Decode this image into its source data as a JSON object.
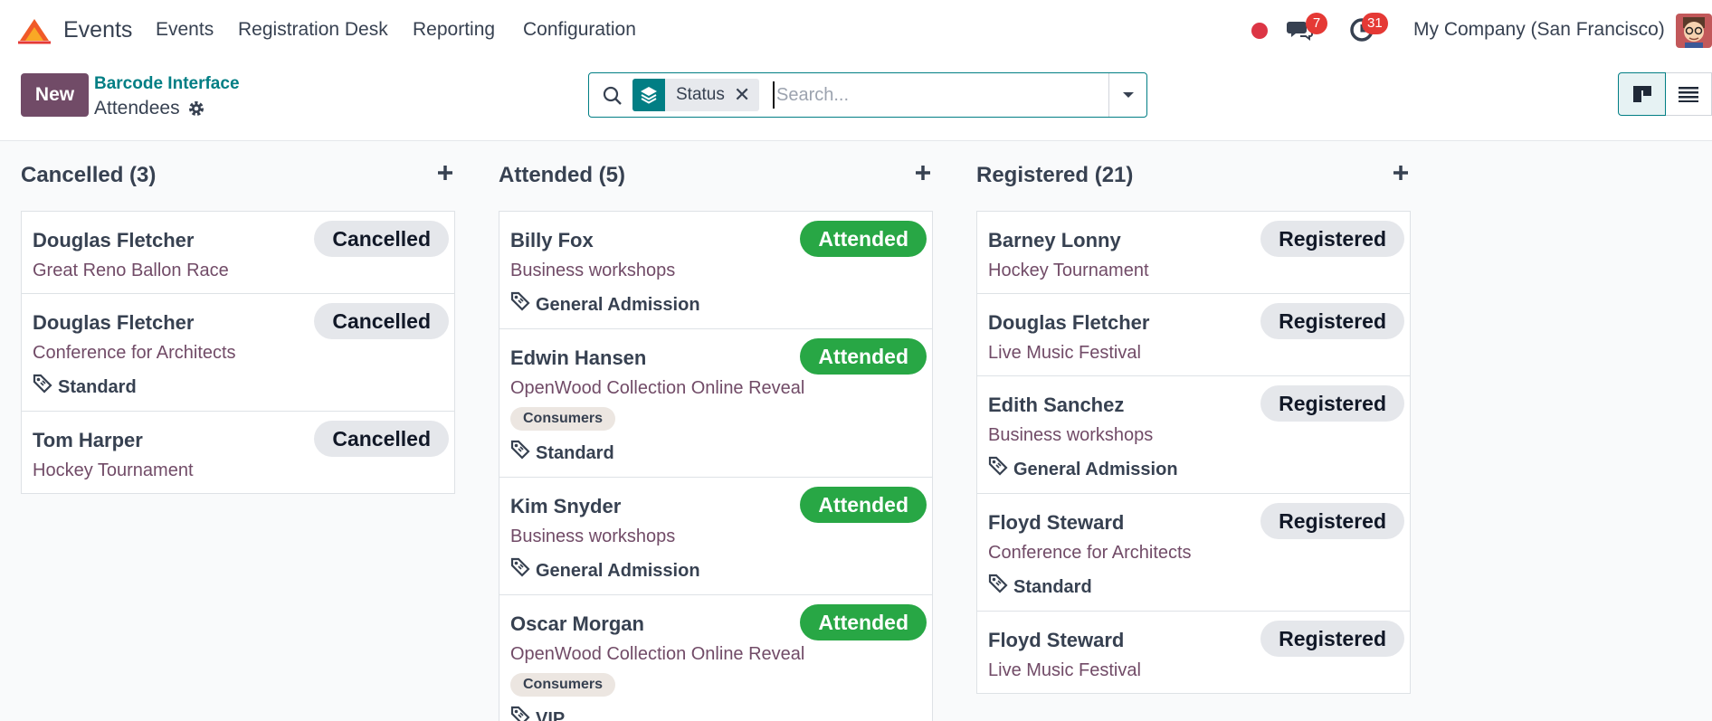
{
  "navbar": {
    "app_name": "Events",
    "menu": [
      "Events",
      "Registration Desk",
      "Reporting",
      "Configuration"
    ],
    "messages_count": "7",
    "activities_count": "31",
    "company": "My Company (San Francisco)",
    "icons": [
      "odoo-logo-icon",
      "recording-dot-icon",
      "chat-icon",
      "clock-icon",
      "user-avatar"
    ]
  },
  "control": {
    "new_label": "New",
    "breadcrumb_link": "Barcode Interface",
    "breadcrumb_current": "Attendees",
    "search": {
      "facet_label": "Status",
      "placeholder": "Search..."
    },
    "views": [
      "kanban-view-icon",
      "list-view-icon"
    ]
  },
  "colors": {
    "brand": "#714b67",
    "accent": "#017e84",
    "attended": "#28a745",
    "badge": "#e53935"
  },
  "columns": [
    {
      "title": "Cancelled (3)",
      "cards": [
        {
          "name": "Douglas Fletcher",
          "event": "Great Reno Ballon Race",
          "status": "Cancelled"
        },
        {
          "name": "Douglas Fletcher",
          "event": "Conference for Architects",
          "ticket": "Standard",
          "status": "Cancelled"
        },
        {
          "name": "Tom Harper",
          "event": "Hockey Tournament",
          "status": "Cancelled"
        }
      ]
    },
    {
      "title": "Attended (5)",
      "cards": [
        {
          "name": "Billy Fox",
          "event": "Business workshops",
          "ticket": "General Admission",
          "status": "Attended"
        },
        {
          "name": "Edwin Hansen",
          "event": "OpenWood Collection Online Reveal",
          "tag": "Consumers",
          "ticket": "Standard",
          "status": "Attended"
        },
        {
          "name": "Kim Snyder",
          "event": "Business workshops",
          "ticket": "General Admission",
          "status": "Attended"
        },
        {
          "name": "Oscar Morgan",
          "event": "OpenWood Collection Online Reveal",
          "tag": "Consumers",
          "ticket": "VIP",
          "status": "Attended"
        }
      ]
    },
    {
      "title": "Registered (21)",
      "cards": [
        {
          "name": "Barney Lonny",
          "event": "Hockey Tournament",
          "status": "Registered"
        },
        {
          "name": "Douglas Fletcher",
          "event": "Live Music Festival",
          "status": "Registered"
        },
        {
          "name": "Edith Sanchez",
          "event": "Business workshops",
          "ticket": "General Admission",
          "status": "Registered"
        },
        {
          "name": "Floyd Steward",
          "event": "Conference for Architects",
          "ticket": "Standard",
          "status": "Registered"
        },
        {
          "name": "Floyd Steward",
          "event": "Live Music Festival",
          "status": "Registered"
        }
      ]
    }
  ]
}
